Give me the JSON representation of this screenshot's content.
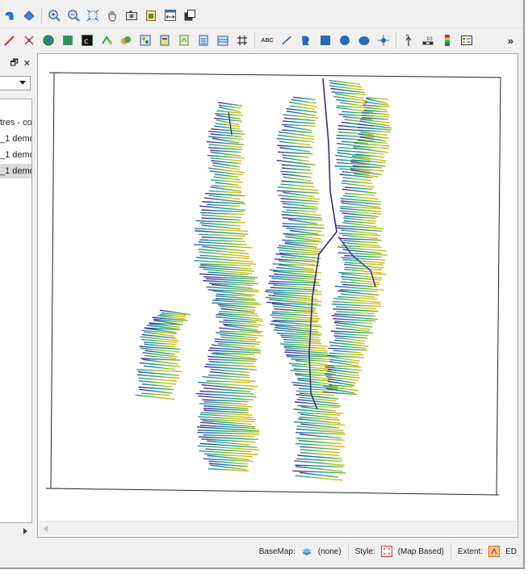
{
  "toolbar_top": {
    "icons": [
      "curve-back-icon",
      "curve-forward-icon",
      "zoom-in-icon",
      "zoom-out-icon",
      "zoom-extents-icon",
      "pan-hand-icon",
      "camera-icon",
      "paste-map-icon",
      "fit-width-icon",
      "copy-window-icon"
    ]
  },
  "toolbar_main": {
    "text_tool_label": "ABC",
    "more_label": "»",
    "icons": [
      "digitize-icon",
      "measure-icon",
      "globe-layer-icon",
      "grid-layer-icon",
      "contour-icon",
      "vector-icon",
      "post-map-icon",
      "classed-post-icon",
      "image-map-icon",
      "shaded-relief-icon",
      "watershed-icon",
      "viewshed-icon",
      "hash-grid-icon",
      "text-icon",
      "polyline-icon",
      "curve-icon",
      "rectangle-icon",
      "circle-icon",
      "ellipse-icon",
      "symbol-icon",
      "north-arrow-icon",
      "scale-bar-icon",
      "color-scale-icon",
      "legend-icon"
    ]
  },
  "side_panel": {
    "restore_glyph": "🗗",
    "close_glyph": "✕",
    "layers": [
      {
        "label": "tres - co",
        "selected": false
      },
      {
        "label": "_1 demo",
        "selected": false
      },
      {
        "label": "_1 demo",
        "selected": false
      },
      {
        "label": "_1 demo",
        "selected": true
      }
    ],
    "scroll_glyph": ">"
  },
  "map": {
    "lines": [
      {
        "start": [
          0.2,
          0.8
        ],
        "end": [
          0.8,
          0.2
        ]
      },
      {
        "start": [
          0.3,
          0.9
        ],
        "end": [
          0.9,
          0.3
        ]
      }
    ]
  },
  "status": {
    "basemap_label": "BaseMap:",
    "basemap_value": "(none)",
    "style_label": "Style:",
    "style_value": "(Map Based)",
    "extent_label": "Extent:",
    "extent_value": "ED"
  },
  "colors": {
    "ramp": [
      "#4a1d8c",
      "#2a57a8",
      "#1c8f9a",
      "#3aa668",
      "#8bbd2e",
      "#c8c417",
      "#e6a40f"
    ],
    "chrome": "#f0f0f0",
    "selected_row": "#d9d9d9"
  }
}
